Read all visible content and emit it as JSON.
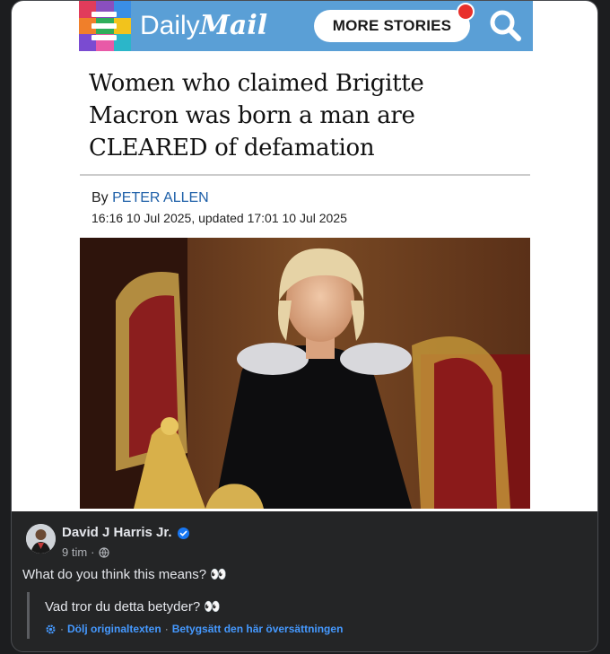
{
  "article_header": {
    "brand_daily": "Daily",
    "brand_mail": "Mail",
    "more_stories_label": "MORE STORIES",
    "logo_colors": [
      "#e13c5b",
      "#8a4fbf",
      "#3a8ee6",
      "#f07f2a",
      "#2fae5a",
      "#f2c31c",
      "#7a4bd1",
      "#e85aa7",
      "#2bb6c9"
    ],
    "header_color": "#5a9fd6"
  },
  "article": {
    "headline": "Women who claimed Brigitte Macron was born a man are CLEARED of defamation",
    "by_label": "By",
    "author": "PETER ALLEN",
    "dates": "16:16 10 Jul 2025, updated 17:01 10 Jul 2025"
  },
  "post": {
    "author_name": "David J Harris Jr.",
    "verified_icon": "verified-badge-icon",
    "time": "9 tim",
    "separator": "·",
    "audience_icon": "globe-icon",
    "text": "What do you think this means? 👀",
    "translation_text": "Vad tror du detta betyder? 👀",
    "translation_icon": "settings-gear-icon",
    "link_hide": "Dölj originaltexten",
    "link_rate": "Betygsätt den här översättningen",
    "link_separator": "·"
  }
}
